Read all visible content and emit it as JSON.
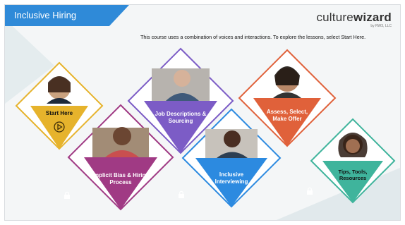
{
  "header": {
    "title": "Inclusive Hiring",
    "logo": {
      "brand_light": "culture",
      "brand_bold": "wizard",
      "tagline": "by RW3, LLC"
    },
    "instructions": "This course uses a combination of voices and interactions. To explore the lessons, select Start Here."
  },
  "colors": {
    "banner": "#2f8ad8",
    "start": "#e6b32c",
    "job": "#7c5cc6",
    "assess": "#e0613a",
    "bias": "#a03a84",
    "interview": "#2c8ae0",
    "tips": "#3fb49c"
  },
  "lessons": [
    {
      "id": "start",
      "label": "Start Here",
      "icon": "play-icon",
      "locked": false
    },
    {
      "id": "job",
      "label": "Job Descriptions & Sourcing",
      "icon": "lock-icon",
      "locked": true
    },
    {
      "id": "assess",
      "label": "Assess, Select, Make Offer",
      "icon": "lock-icon",
      "locked": true
    },
    {
      "id": "bias",
      "label": "Implicit Bias & Hiring Process",
      "icon": "lock-icon",
      "locked": true
    },
    {
      "id": "interview",
      "label": "Inclusive Interviewing",
      "icon": "lock-icon",
      "locked": true
    },
    {
      "id": "tips",
      "label": "Tips, Tools, Resources",
      "icon": "lock-icon",
      "locked": true
    }
  ]
}
